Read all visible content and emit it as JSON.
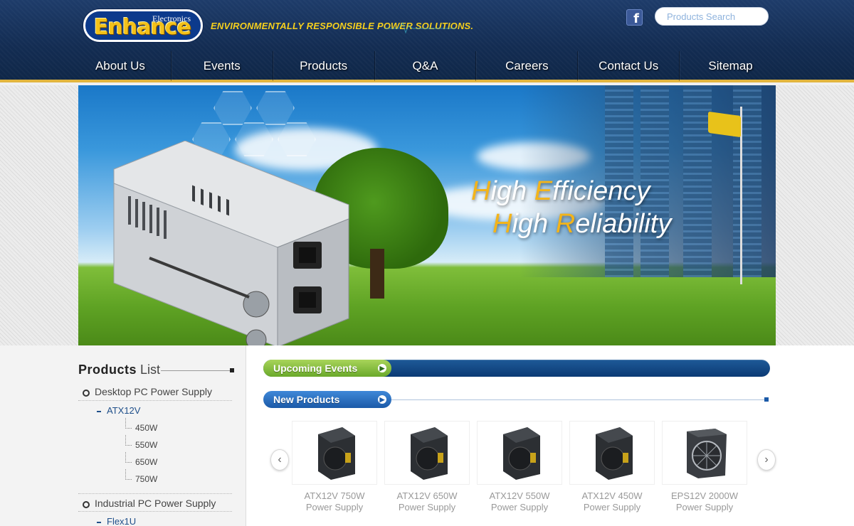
{
  "header": {
    "logo_word": "Enhance",
    "logo_sub": "Electronics",
    "tagline": "ENVIRONMENTALLY RESPONSIBLE POWER SOLUTIONS.",
    "search": {
      "placeholder": "Products Search"
    }
  },
  "nav": [
    {
      "label": "About Us"
    },
    {
      "label": "Events"
    },
    {
      "label": "Products"
    },
    {
      "label": "Q&A"
    },
    {
      "label": "Careers"
    },
    {
      "label": "Contact Us"
    },
    {
      "label": "Sitemap"
    }
  ],
  "banner": {
    "line1": {
      "cap": "H",
      "rest": "igh ",
      "cap2": "E",
      "rest2": "fficiency"
    },
    "line2": {
      "cap": "H",
      "rest": "igh ",
      "cap2": "R",
      "rest2": "eliability"
    }
  },
  "sidebar": {
    "title_strong": "Products",
    "title_light": "List",
    "categories": [
      {
        "label": "Desktop PC Power Supply",
        "sub": {
          "label": "ATX12V",
          "items": [
            "450W",
            "550W",
            "650W",
            "750W"
          ]
        }
      },
      {
        "label": "Industrial PC Power Supply",
        "sub": {
          "label": "Flex1U"
        }
      }
    ]
  },
  "main": {
    "upcoming_events": "Upcoming Events",
    "new_products": "New Products",
    "products": [
      {
        "name": "ATX12V 750W",
        "type": "Power Supply"
      },
      {
        "name": "ATX12V 650W",
        "type": "Power Supply"
      },
      {
        "name": "ATX12V 550W",
        "type": "Power Supply"
      },
      {
        "name": "ATX12V 450W",
        "type": "Power Supply"
      },
      {
        "name": "EPS12V 2000W",
        "type": "Power Supply"
      }
    ]
  },
  "colors": {
    "header_bg": "#132c52",
    "accent_gold": "#e2b53e",
    "tagline": "#f5cf1d",
    "events_green": "#6aa92a",
    "products_blue": "#1b5aa8"
  },
  "icons": {
    "facebook": "facebook-icon",
    "prev": "chevron-left-icon",
    "next": "chevron-right-icon",
    "arrow": "arrow-right-circle-icon"
  }
}
